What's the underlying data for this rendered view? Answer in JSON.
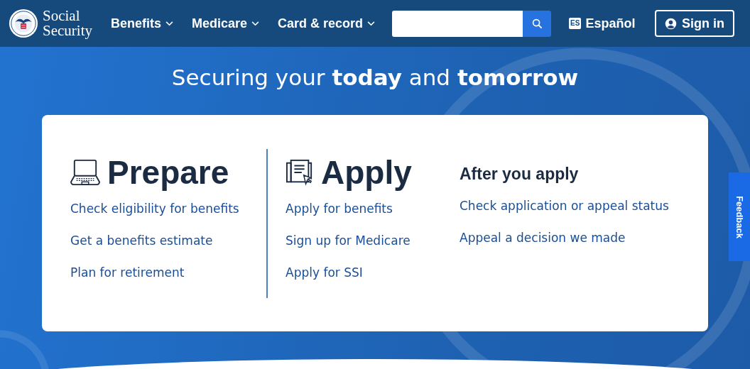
{
  "header": {
    "logo_text": [
      "Social",
      "Security"
    ],
    "nav": [
      {
        "label": "Benefits",
        "expanded": false
      },
      {
        "label": "Medicare",
        "expanded": false
      },
      {
        "label": "Card & record",
        "expanded": false
      }
    ],
    "language_link": {
      "badge": "ES",
      "label": "Español"
    },
    "sign_in": "Sign in"
  },
  "hero": {
    "headline": "Securing your **today** and **tomorrow**"
  },
  "sections": [
    {
      "kind": "laptop",
      "title": "Prepare",
      "links": [
        "Check eligibility for benefits",
        "Get a benefits estimate",
        "Plan for retirement"
      ]
    },
    {
      "kind": "document",
      "title": "Apply",
      "links": [
        "Apply for benefits",
        "Sign up for Medicare",
        "Apply for SSI"
      ]
    },
    {
      "kind": "plain",
      "title": "After you apply",
      "links": [
        "Check application or appeal status",
        "Appeal a decision we made"
      ]
    }
  ],
  "feedback_tab": "Feedback"
}
